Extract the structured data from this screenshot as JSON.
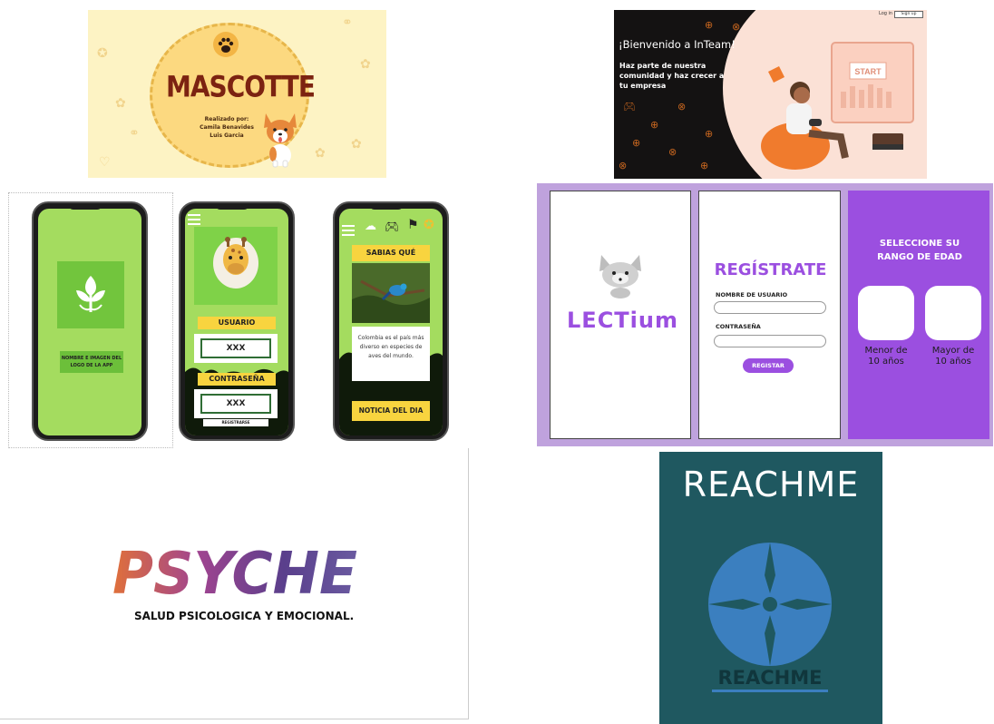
{
  "mascotte": {
    "title": "MASCOTTE",
    "credits_heading": "Realizado por:",
    "author1": "Camila Benavides",
    "author2": "Luis Garcia"
  },
  "inteam": {
    "welcome": "¡Bienvenido a InTeam!",
    "desc": "Haz parte de nuestra comunidad y haz crecer a tu empresa",
    "login": "Log in",
    "signup": "Sign up",
    "start_label": "START"
  },
  "phones": {
    "app_logo_text": "NOMBRE E IMAGEN DEL LOGO DE LA APP",
    "usuario_label": "USUARIO",
    "usuario_value": "XXX",
    "contrasena_label": "CONTRASEÑA",
    "contrasena_value": "XXX",
    "registrarse": "REGISTRARSE",
    "sabias_que": "SABIAS QUÉ",
    "fact": "Colombia es el país más diverso en especies de aves del mundo.",
    "noticia": "NOTICIA DEL DIA"
  },
  "lectium": {
    "logo": "LECTium",
    "register_title": "REGÍSTRATE",
    "username_label": "NOMBRE DE USUARIO",
    "password_label": "CONTRASEÑA",
    "register_button": "REGISTAR",
    "age_title_line1": "SELECCIONE SU",
    "age_title_line2": "RANGO DE EDAD",
    "under10": "Menor de 10 años",
    "over10": "Mayor de 10 años",
    "accent": "#9b4fe0"
  },
  "psyche": {
    "title": "PSYCHE",
    "subtitle": "SALUD PSICOLOGICA Y EMOCIONAL."
  },
  "reachme": {
    "title": "REACHME",
    "logo_text": "REACHME"
  }
}
